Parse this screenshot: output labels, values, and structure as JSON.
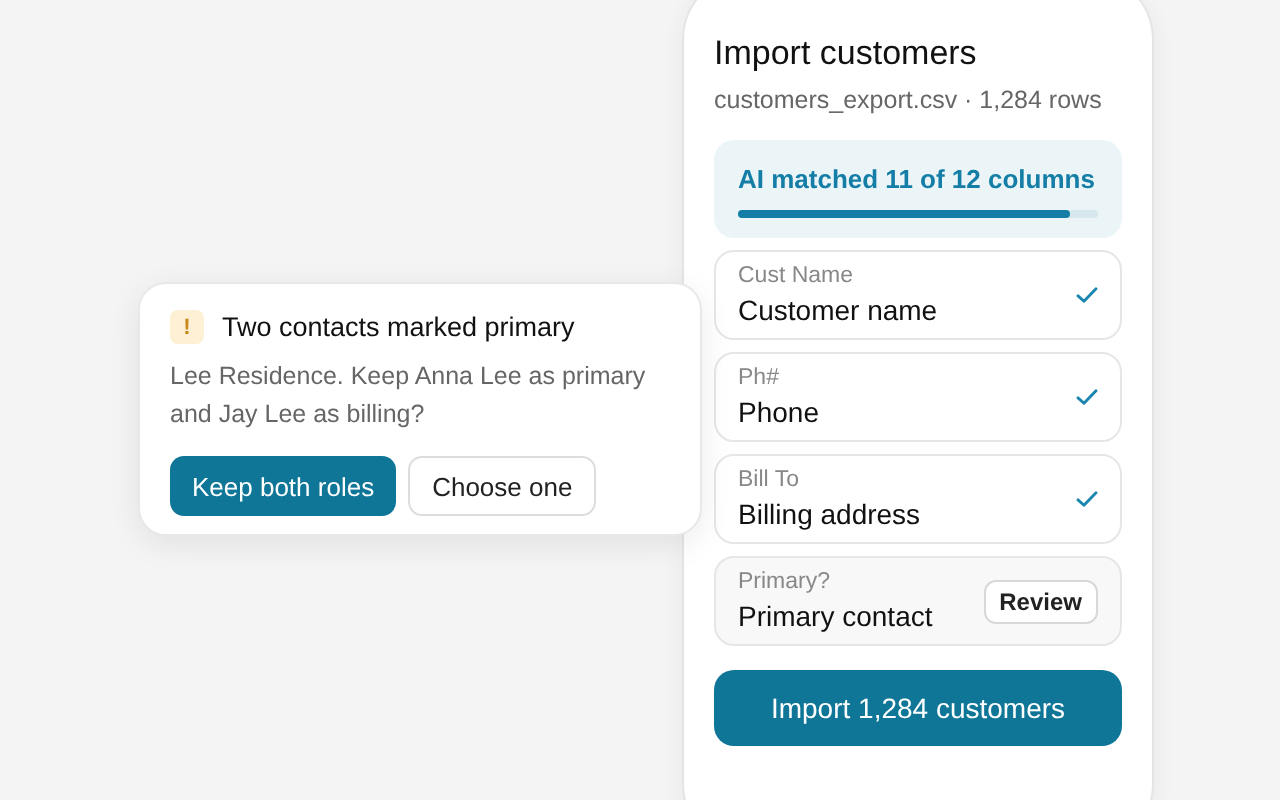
{
  "importer": {
    "title": "Import customers",
    "subtitle": "customers_export.csv · 1,284 rows",
    "match": {
      "label": "AI matched 11 of 12 columns",
      "level": 0.92
    },
    "mappings": [
      {
        "kind": "matched",
        "source": "Cust Name",
        "target": "Customer name"
      },
      {
        "kind": "matched",
        "source": "Ph#",
        "target": "Phone"
      },
      {
        "kind": "matched",
        "source": "Bill To",
        "target": "Billing address"
      },
      {
        "kind": "review",
        "source": "Primary?",
        "target": "Primary contact",
        "action": "Review"
      }
    ],
    "import_button": "Import 1,284 customers"
  },
  "alert": {
    "icon": "!",
    "title": "Two contacts marked primary",
    "message": "Lee Residence. Keep Anna Lee as primary and Jay Lee as billing?",
    "buttons": [
      {
        "label": "Keep both roles",
        "kind": "primary"
      },
      {
        "label": "Choose one",
        "kind": "secondary"
      }
    ]
  }
}
